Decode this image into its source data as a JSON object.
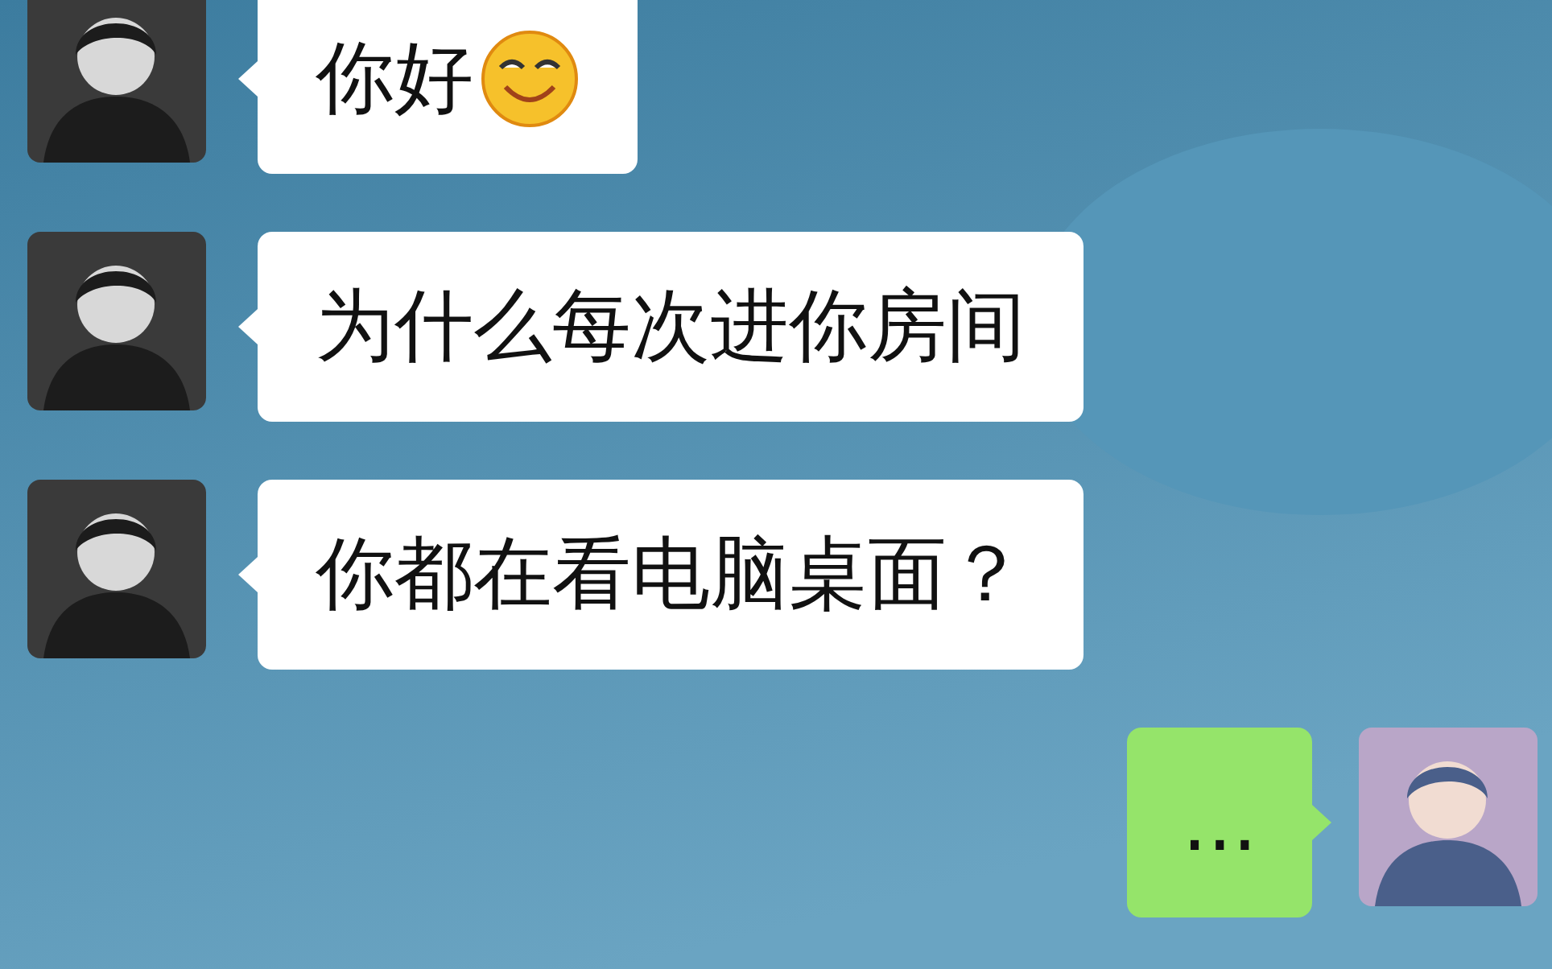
{
  "messages": [
    {
      "kind": "incoming",
      "text": "你好",
      "emoji": true
    },
    {
      "kind": "incoming",
      "text": "为什么每次进你房间",
      "emoji": false
    },
    {
      "kind": "incoming",
      "text": "你都在看电脑桌面？",
      "emoji": false
    },
    {
      "kind": "outgoing",
      "text": "...",
      "emoji": false
    }
  ]
}
